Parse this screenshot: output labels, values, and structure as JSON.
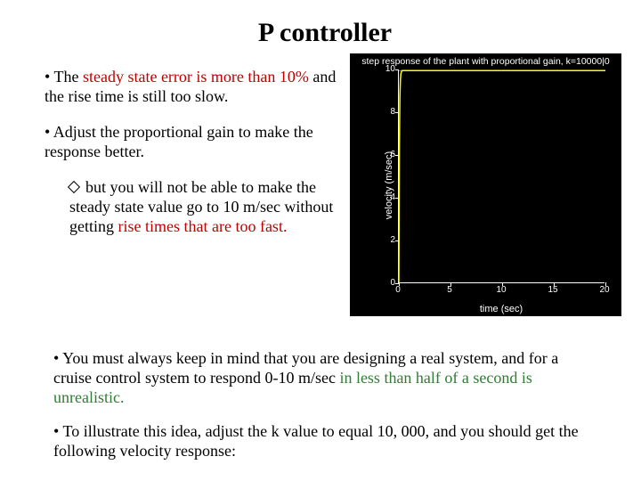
{
  "title": "P controller",
  "bullets": {
    "b1_pre": "• The ",
    "b1_red": "steady state error is more than 10% ",
    "b1_post": "and the rise time is still too slow.",
    "b2": "• Adjust the proportional gain to make the response better.",
    "sub_pre": "but you will not be able to make the steady state value go to 10 m/sec without getting ",
    "sub_red": "rise times that are too fast.",
    "b3_pre": "• You must always keep in mind that you are designing a real system, and for a cruise control system to respond 0-10 m/sec ",
    "b3_green": "in less than half of a second is unrealistic.",
    "b4": "• To illustrate this idea, adjust the k value to equal 10, 000, and you should get the following velocity response:"
  },
  "chart_data": {
    "type": "line",
    "title": "step response of the plant with proportional gain, k=10000|0",
    "xlabel": "time (sec)",
    "ylabel": "velocity (m/sec)",
    "xlim": [
      0,
      20
    ],
    "ylim": [
      0,
      10
    ],
    "xticks": [
      0,
      5,
      10,
      15,
      20
    ],
    "yticks": [
      0,
      2,
      4,
      6,
      8,
      10
    ],
    "x": [
      0,
      0.05,
      0.1,
      0.15,
      0.2,
      0.3,
      0.5,
      1,
      2,
      5,
      10,
      15,
      20
    ],
    "y": [
      0,
      6.3,
      8.7,
      9.5,
      9.8,
      9.95,
      9.95,
      9.95,
      9.95,
      9.95,
      9.95,
      9.95,
      9.95
    ],
    "dashed_reference": 9.95
  }
}
